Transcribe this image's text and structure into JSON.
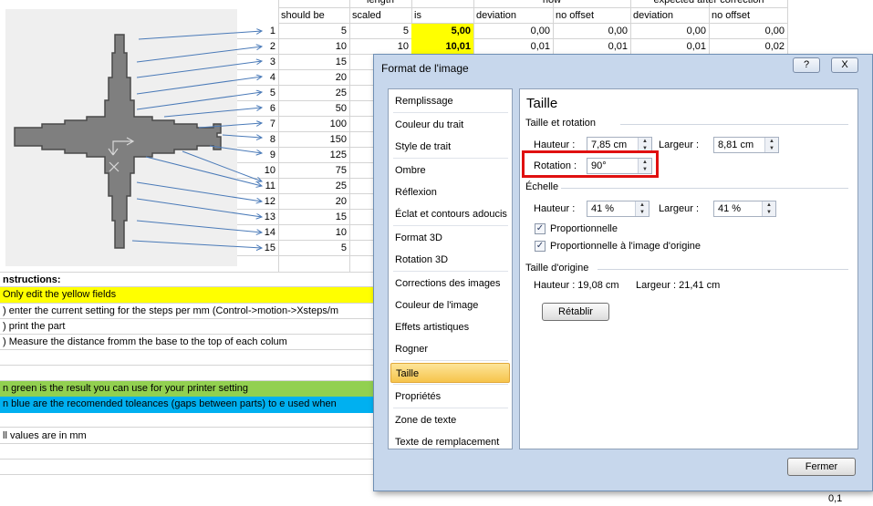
{
  "sheet": {
    "headers_top": [
      "length",
      "how",
      "expected after correction"
    ],
    "headers": [
      "should be",
      "scaled",
      "is",
      "deviation",
      "no offset",
      "deviation",
      "no offset"
    ],
    "rows": [
      {
        "n": "1",
        "should": "5",
        "scaled": "5",
        "is": "5,00",
        "dev": "0,00",
        "nooff": "0,00",
        "edev": "0,00",
        "enooff": "0,00"
      },
      {
        "n": "2",
        "should": "10",
        "scaled": "10",
        "is": "10,01",
        "dev": "0,01",
        "nooff": "0,01",
        "edev": "0,01",
        "enooff": "0,02"
      },
      {
        "n": "3",
        "should": "15"
      },
      {
        "n": "4",
        "should": "20"
      },
      {
        "n": "5",
        "should": "25"
      },
      {
        "n": "6",
        "should": "50"
      },
      {
        "n": "7",
        "should": "100"
      },
      {
        "n": "8",
        "should": "150"
      },
      {
        "n": "9",
        "should": "125"
      },
      {
        "n": "10",
        "should": "75"
      },
      {
        "n": "11",
        "should": "25"
      },
      {
        "n": "12",
        "should": "20"
      },
      {
        "n": "13",
        "should": "15"
      },
      {
        "n": "14",
        "should": "10"
      },
      {
        "n": "15",
        "should": "5"
      }
    ],
    "instructions_title": "nstructions:",
    "line_yellow": "Only edit the yellow fields",
    "line_1": ") enter the current setting for the steps per mm (Control->motion->Xsteps/m",
    "line_2": ") print the part",
    "line_3": ") Measure the distance fromm the base to the top of each colum",
    "line_green": "n green is the result you can use for your printer setting",
    "line_blue": "n blue are the recomended toleances (gaps between parts) to e used when",
    "line_units": "ll values are in mm",
    "edge_right": "0",
    "bottom_value": "0,1"
  },
  "dialog": {
    "title": "Format de l'image",
    "help_label": "?",
    "close_label": "X",
    "nav": [
      "Remplissage",
      "Couleur du trait",
      "Style de trait",
      "Ombre",
      "Réflexion",
      "Éclat et contours adoucis",
      "Format 3D",
      "Rotation 3D",
      "Corrections des images",
      "Couleur de l'image",
      "Effets artistiques",
      "Rogner",
      "Taille",
      "Propriétés",
      "Zone de texte",
      "Texte de remplacement"
    ],
    "selected_nav": "Taille",
    "panel_title": "Taille",
    "sec_size_rotation": "Taille et rotation",
    "height_label": "Hauteur :",
    "height_value": "7,85 cm",
    "width_label": "Largeur :",
    "width_value": "8,81 cm",
    "rotation_label": "Rotation :",
    "rotation_value": "90°",
    "sec_scale": "Échelle",
    "scale_height_label": "Hauteur :",
    "scale_height_value": "41 %",
    "scale_width_label": "Largeur :",
    "scale_width_value": "41 %",
    "proportional": "Proportionnelle",
    "proportional_original": "Proportionnelle à l'image d'origine",
    "sec_original": "Taille d'origine",
    "orig_height": "Hauteur :     19,08 cm",
    "orig_width": "Largeur :    21,41 cm",
    "reset_button": "Rétablir",
    "close_button": "Fermer"
  }
}
